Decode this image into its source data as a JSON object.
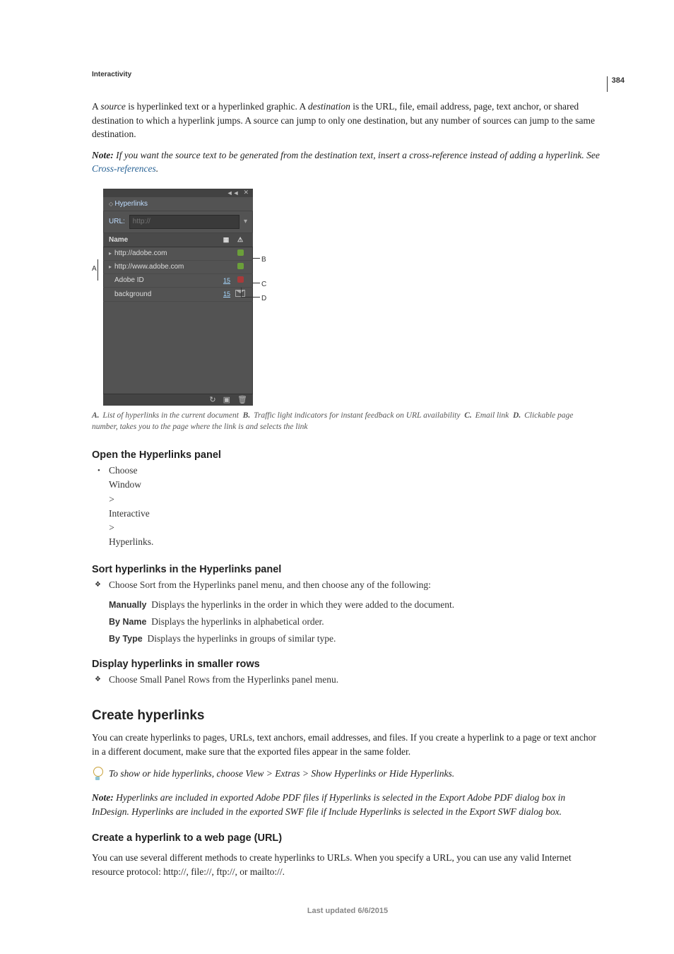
{
  "pageNumber": "384",
  "chapter": "Interactivity",
  "intro": {
    "sourceDef": "A source is hyperlinked text or a hyperlinked graphic. A destination is the URL, file, email address, page, text anchor, or shared destination to which a hyperlink jumps. A source can jump to only one destination, but any number of sources can jump to the same destination."
  },
  "note1": {
    "lead": "Note:",
    "body": "If you want the source text to be generated from the destination text, insert a cross-reference instead of adding a hyperlink. See ",
    "link": "Cross-references",
    "tail": "."
  },
  "panel": {
    "tab": "Hyperlinks",
    "urlLabel": "URL:",
    "urlPlaceholder": "http://",
    "nameHeader": "Name",
    "pageIcon": "⊞",
    "trafficIcon": "⚠",
    "rows": [
      {
        "name": "http://adobe.com",
        "pg": "",
        "dot": "green",
        "mail": false
      },
      {
        "name": "http://www.adobe.com",
        "pg": "",
        "dot": "green",
        "mail": false
      },
      {
        "name": "Adobe ID",
        "pg": "15",
        "dot": "red",
        "mail": false
      },
      {
        "name": "background",
        "pg": "15",
        "dot": "mail",
        "mail": true
      }
    ]
  },
  "caption": {
    "a": {
      "lab": "A.",
      "text": "List of hyperlinks in the current document"
    },
    "b": {
      "lab": "B.",
      "text": "Traffic light indicators for instant feedback on URL availability"
    },
    "c": {
      "lab": "C.",
      "text": "Email link"
    },
    "d": {
      "lab": "D.",
      "text": "Clickable page number, takes you to the page where the link is and selects the link"
    }
  },
  "sections": {
    "openPanel": {
      "title": "Open the Hyperlinks panel",
      "item": "Choose Window > Interactive > Hyperlinks."
    },
    "sort": {
      "title": "Sort hyperlinks in the Hyperlinks panel",
      "lead": "Choose Sort from the Hyperlinks panel menu, and then choose any of the following:",
      "defs": [
        {
          "term": "Manually",
          "def": "Displays the hyperlinks in the order in which they were added to the document."
        },
        {
          "term": "By Name",
          "def": "Displays the hyperlinks in alphabetical order."
        },
        {
          "term": "By Type",
          "def": "Displays the hyperlinks in groups of similar type."
        }
      ]
    },
    "smaller": {
      "title": "Display hyperlinks in smaller rows",
      "item": "Choose Small Panel Rows from the Hyperlinks panel menu."
    }
  },
  "createSection": {
    "title": "Create hyperlinks",
    "intro": "You can create hyperlinks to pages, URLs, text anchors, email addresses, and files. If you create a hyperlink to a page or text anchor in a different document, make sure that the exported files appear in the same folder.",
    "tip": "To show or hide hyperlinks, choose View > Extras > Show Hyperlinks or Hide Hyperlinks.",
    "note": {
      "lead": "Note:",
      "body": "Hyperlinks are included in exported Adobe PDF files if Hyperlinks is selected in the Export Adobe PDF dialog box in InDesign. Hyperlinks are included in the exported SWF file if Include Hyperlinks is selected in the Export SWF dialog box."
    },
    "urlSub": {
      "title": "Create a hyperlink to a web page (URL)",
      "body": "You can use several different methods to create hyperlinks to URLs. When you specify a URL, you can use any valid Internet resource protocol: http://, file://, ftp://, or mailto://."
    }
  },
  "footer": "Last updated 6/6/2015"
}
